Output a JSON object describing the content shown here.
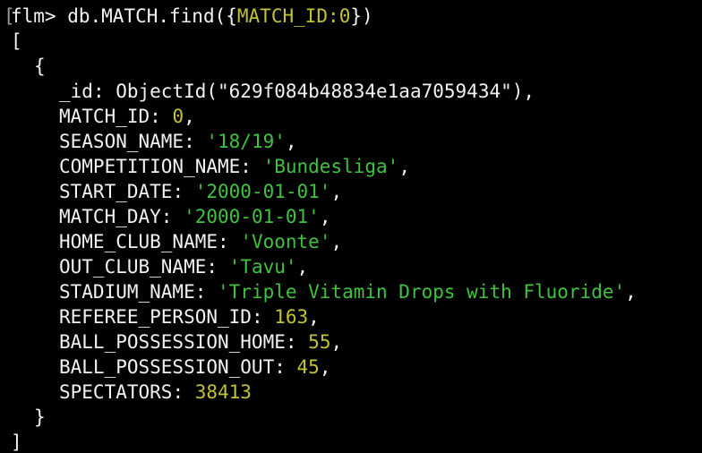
{
  "prompt": {
    "marker": "[",
    "name": "flm>",
    "command_pre": "db.MATCH.find({",
    "query_key": "MATCH_ID",
    "query_colon": ":",
    "query_value": "0",
    "command_post": "})"
  },
  "result": {
    "open_bracket": "[",
    "open_brace": "{",
    "close_brace": "}",
    "close_bracket": "]",
    "fields": [
      {
        "key": "_id",
        "value": "ObjectId(\"629f084b48834e1aa7059434\")",
        "type": "plain",
        "sep": ","
      },
      {
        "key": "MATCH_ID",
        "value": "0",
        "type": "num",
        "sep": ","
      },
      {
        "key": "SEASON_NAME",
        "value": "'18/19'",
        "type": "str",
        "sep": ","
      },
      {
        "key": "COMPETITION_NAME",
        "value": "'Bundesliga'",
        "type": "str",
        "sep": ","
      },
      {
        "key": "START_DATE",
        "value": "'2000-01-01'",
        "type": "str",
        "sep": ","
      },
      {
        "key": "MATCH_DAY",
        "value": "'2000-01-01'",
        "type": "str",
        "sep": ","
      },
      {
        "key": "HOME_CLUB_NAME",
        "value": "'Voonte'",
        "type": "str",
        "sep": ","
      },
      {
        "key": "OUT_CLUB_NAME",
        "value": "'Tavu'",
        "type": "str",
        "sep": ","
      },
      {
        "key": "STADIUM_NAME",
        "value": "'Triple Vitamin Drops with Fluoride'",
        "type": "str",
        "sep": ","
      },
      {
        "key": "REFEREE_PERSON_ID",
        "value": "163",
        "type": "num",
        "sep": ","
      },
      {
        "key": "BALL_POSSESSION_HOME",
        "value": "55",
        "type": "num",
        "sep": ","
      },
      {
        "key": "BALL_POSSESSION_OUT",
        "value": "45",
        "type": "num",
        "sep": ","
      },
      {
        "key": "SPECTATORS",
        "value": "38413",
        "type": "num",
        "sep": ""
      }
    ]
  },
  "colors": {
    "background": "#000000",
    "text": "#f2f2f2",
    "number": "#c2c236",
    "string": "#3fc23f"
  }
}
